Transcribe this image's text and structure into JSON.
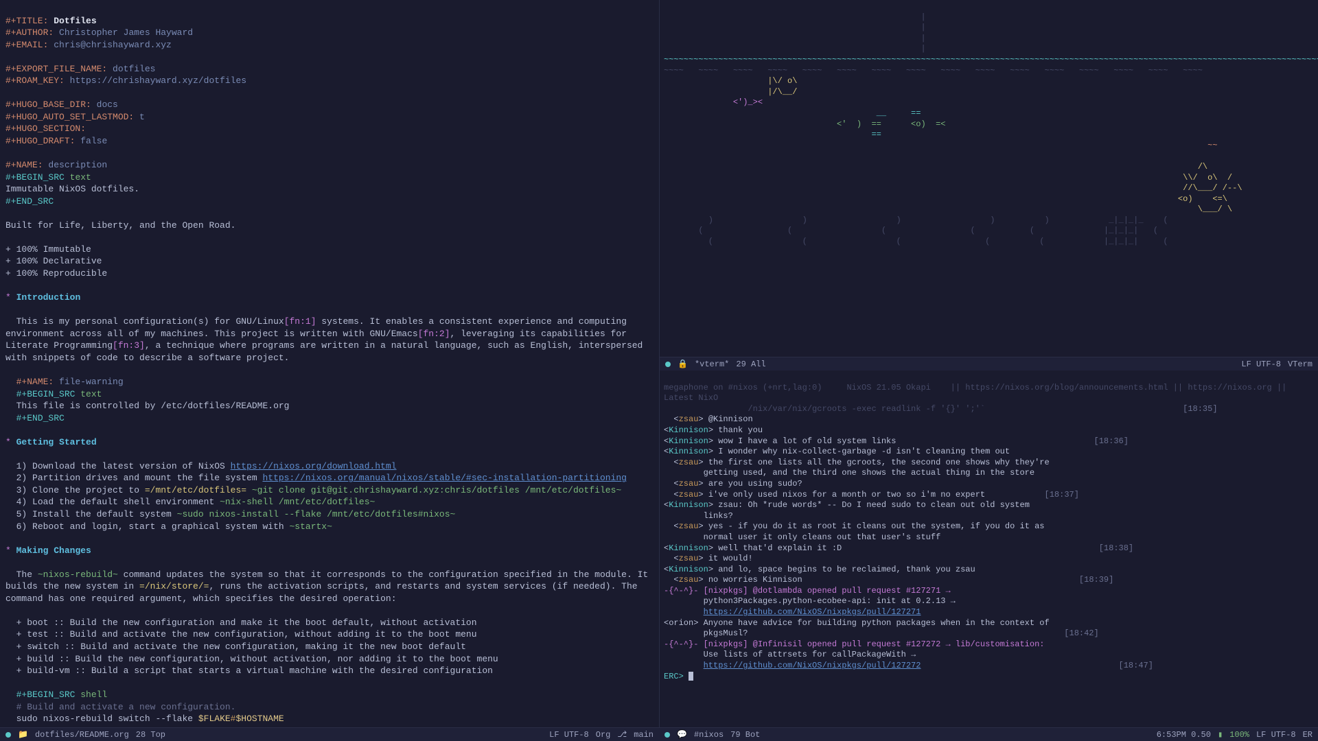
{
  "org": {
    "title_kw": "#+TITLE:",
    "title": "Dotfiles",
    "author_kw": "#+AUTHOR:",
    "author": "Christopher James Hayward",
    "email_kw": "#+EMAIL:",
    "email": "chris@chrishayward.xyz",
    "export_kw": "#+EXPORT_FILE_NAME:",
    "export": "dotfiles",
    "roam_kw": "#+ROAM_KEY:",
    "roam": "https://chrishayward.xyz/dotfiles",
    "hugo_base_kw": "#+HUGO_BASE_DIR:",
    "hugo_base": "docs",
    "hugo_lastmod_kw": "#+HUGO_AUTO_SET_LASTMOD:",
    "hugo_lastmod": "t",
    "hugo_section_kw": "#+HUGO_SECTION:",
    "hugo_draft_kw": "#+HUGO_DRAFT:",
    "hugo_draft": "false",
    "name1_kw": "#+NAME:",
    "name1": "description",
    "begin_src": "#+BEGIN_SRC",
    "lang_text": "text",
    "desc_body": "Immutable NixOS dotfiles.",
    "end_src": "#+END_SRC",
    "built": "Built for Life, Liberty, and the Open Road.",
    "b1": "+ 100% Immutable",
    "b2": "+ 100% Declarative",
    "b3": "+ 100% Reproducible",
    "h1": "Introduction",
    "p1a": "This is my personal configuration(s) for GNU/Linux",
    "fn1": "[fn:1]",
    "p1b": " systems. It enables a consistent experience and computing environment across all of my machines. This project is written with GNU/Emacs",
    "fn2": "[fn:2]",
    "p1c": ", leveraging its capabilities for Literate Programming",
    "fn3": "[fn:3]",
    "p1d": ", a technique where programs are written in a natural language, such as English, interspersed with snippets of code to describe a software project.",
    "name2": "file-warning",
    "warnbody": "This file is controlled by /etc/dotfiles/README.org",
    "h2": "Getting Started",
    "s1a": "1) Download the latest version of NixOS ",
    "s1l": "https://nixos.org/download.html",
    "s2a": "2) Partition drives and mount the file system ",
    "s2l": "https://nixos.org/manual/nixos/stable/#sec-installation-partitioning",
    "s3a": "3) Clone the project to ",
    "s3p": "=/mnt/etc/dotfiles=",
    "s3c": " ~git clone git@git.chrishayward.xyz:chris/dotfiles /mnt/etc/dotfiles~",
    "s4a": "4) Load the default shell environment ",
    "s4c": "~nix-shell /mnt/etc/dotfiles~",
    "s5a": "5) Install the default system ",
    "s5c": "~sudo nixos-install --flake /mnt/etc/dotfiles#nixos~",
    "s6a": "6) Reboot and login, start a graphical system with ",
    "s6c": "~startx~",
    "h3": "Making Changes",
    "mc1": "The ",
    "nrb": "~nixos-rebuild~",
    "mc2": " command updates the system so that it corresponds to the configuration specified in the module. It builds the new system in ",
    "nst": "=/nix/store/=",
    "mc3": ", runs the activation scripts, and restarts and system services (if needed). The command has one required argument, which specifies the desired operation:",
    "op1": "+ boot :: Build the new configuration and make it the boot default, without activation",
    "op2": "+ test :: Build and activate the new configuration, without adding it to the boot menu",
    "op3": "+ switch :: Build and activate the new configuration, making it the new boot default",
    "op4": "+ build :: Build the new configuration, without activation, nor adding it to the boot menu",
    "op5": "+ build-vm :: Build a script that starts a virtual machine with the desired configuration",
    "lang_shell": "shell",
    "shell_comment": "# Build and activate a new configuration.",
    "shell_cmd": "sudo nixos-rebuild switch --flake ",
    "flake": "$FLAKE",
    "hash": "#",
    "hostname": "$HOSTNAME"
  },
  "vterm": {
    "waves": "~~~~~~~~~~~~~~~~~~~~~~~~~~~~~~~~~~~~~~~~~~~~~~~~~~~~~~~~~~~~~~~~~~~~~~~~~~~~~~~~~~~~~~~~~~~~~~~~~~~~~~~~~~~~~~~~~~~~~~~~~~~~~~~~~~~~~~~~~~~~~~~~~~~~~~~~~~~~~~~~",
    "fish1": "                     |\\/ o\\",
    "fish1b": "                     |/\\__/",
    "fish2": "              <')_><",
    "fish3a": "                                           __     ==",
    "fish3b": "                                   <'  )  ==      <o)  =<",
    "fish3c": "                                          ==",
    "plants": "         )                  )                  )                  )          )            _|_|_|_    (",
    "ml": {
      "buffer": "*vterm*",
      "pos": "29 All",
      "enc": "LF UTF-8",
      "mode": "VTerm"
    }
  },
  "erc": {
    "header": "megaphone on #nixos (+nrt,lag:0)     NixOS 21.05 Okapi    || https://nixos.org/blog/announcements.html || https://nixos.org || Latest NixO",
    "header2": "                 /nix/var/nix/gcroots -exec readlink -f '{}' ';'`",
    "t1": "[18:35]",
    "msgs": [
      {
        "n": "zsau",
        "c": "nick2",
        "t": "",
        "m": "@Kinnison"
      },
      {
        "n": "Kinnison",
        "c": "nick1",
        "t": "",
        "m": "thank you"
      },
      {
        "n": "Kinnison",
        "c": "nick1",
        "t": "[18:36]",
        "m": "wow I have a lot of old system links"
      },
      {
        "n": "Kinnison",
        "c": "nick1",
        "t": "",
        "m": "I wonder why nix-collect-garbage -d isn't cleaning them out"
      },
      {
        "n": "zsau",
        "c": "nick2",
        "t": "",
        "m": "the first one lists all the gcroots, the second one shows why they're"
      },
      {
        "n": "",
        "c": "",
        "t": "",
        "m": "        getting used, and the third one shows the actual thing in the store"
      },
      {
        "n": "zsau",
        "c": "nick2",
        "t": "",
        "m": "are you using sudo?"
      },
      {
        "n": "zsau",
        "c": "nick2",
        "t": "[18:37]",
        "m": "i've only used nixos for a month or two so i'm no expert"
      },
      {
        "n": "Kinnison",
        "c": "nick1",
        "t": "",
        "m": "zsau: Oh *rude words* -- Do I need sudo to clean out old system"
      },
      {
        "n": "",
        "c": "",
        "t": "",
        "m": "        links?"
      },
      {
        "n": "zsau",
        "c": "nick2",
        "t": "",
        "m": "yes - if you do it as root it cleans out the system, if you do it as"
      },
      {
        "n": "",
        "c": "",
        "t": "",
        "m": "        normal user it only cleans out that user's stuff"
      },
      {
        "n": "Kinnison",
        "c": "nick1",
        "t": "[18:38]",
        "m": "well that'd explain it :D"
      },
      {
        "n": "zsau",
        "c": "nick2",
        "t": "",
        "m": "it would!"
      },
      {
        "n": "Kinnison",
        "c": "nick1",
        "t": "",
        "m": "and lo, space begins to be reclaimed, thank you zsau"
      },
      {
        "n": "zsau",
        "c": "nick2",
        "t": "[18:39]",
        "m": "no worries Kinnison"
      }
    ],
    "pr1a": "-{^-^}- [nixpkgs] @dotlambda opened pull request #127271 →",
    "pr1b": "        python3Packages.python-ecobee-api: init at 0.2.13 →",
    "pr1l": "https://github.com/NixOS/nixpkgs/pull/127271",
    "or1": "<orion> Anyone have advice for building python packages when in the context of",
    "or2": "        pkgsMusl?",
    "t42": "[18:42]",
    "pr2a": "-{^-^}- [nixpkgs] @Infinisil opened pull request #127272 → lib/customisation:",
    "pr2b": "        Use lists of attrsets for callPackageWith →",
    "pr2l": "https://github.com/NixOS/nixpkgs/pull/127272",
    "t47": "[18:47]",
    "prompt": "ERC>",
    "ml": {
      "buffer": "#nixos",
      "pos": "79 Bot",
      "time": "6:53PM 0.50",
      "batt": "100%",
      "enc": "LF UTF-8",
      "mode": "ER"
    }
  },
  "left_ml": {
    "file": "dotfiles/README.org",
    "pos": "28 Top",
    "enc": "LF UTF-8",
    "mode": "Org",
    "branch": "main"
  }
}
